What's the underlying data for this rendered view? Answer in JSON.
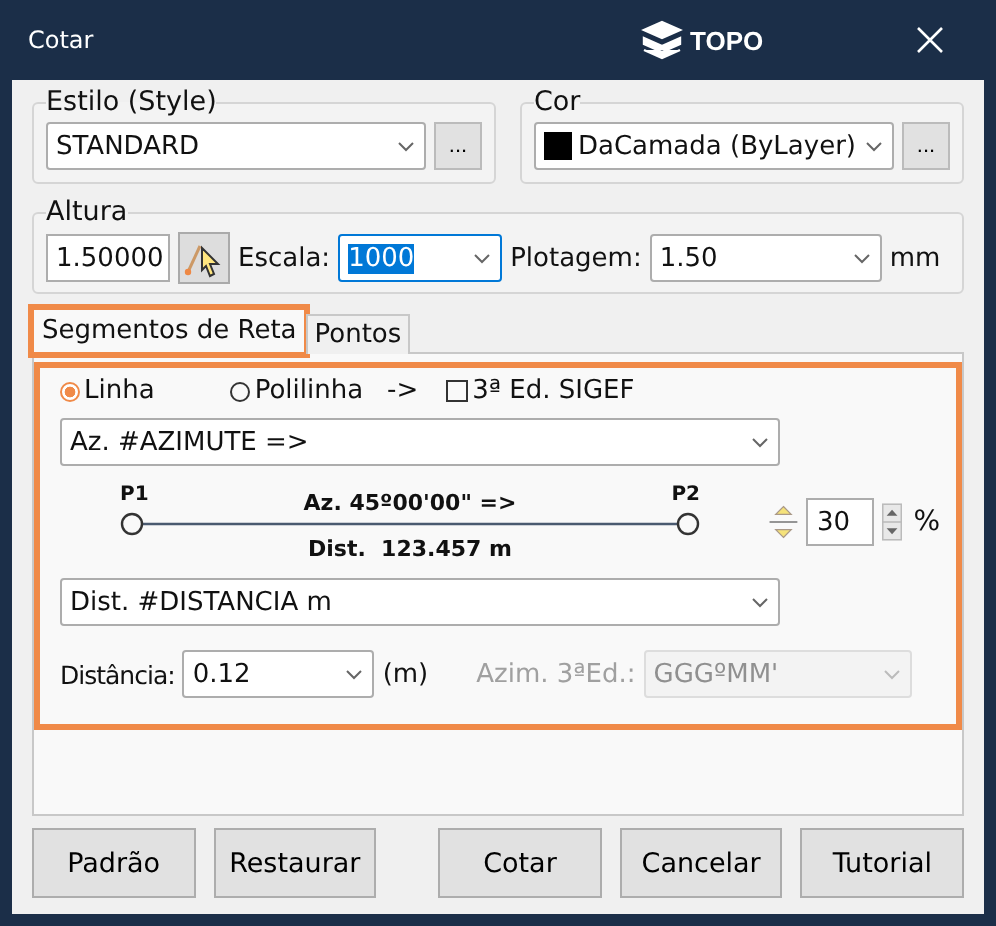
{
  "window": {
    "title": "Cotar",
    "logo_text": "TOPO"
  },
  "style_group": {
    "label": "Estilo (Style)",
    "value": "STANDARD",
    "more": "..."
  },
  "color_group": {
    "label": "Cor",
    "value": "DaCamada (ByLayer)",
    "more": "..."
  },
  "height_group": {
    "label": "Altura",
    "value": "1.50000",
    "scale_label": "Escala:",
    "scale_value": "1000",
    "plot_label": "Plotagem:",
    "plot_value": "1.50",
    "unit": "mm"
  },
  "tabs": [
    {
      "label": "Segmentos de Reta",
      "selected": true,
      "highlighted": true
    },
    {
      "label": "Pontos",
      "selected": false,
      "highlighted": false
    }
  ],
  "panel": {
    "highlighted": true,
    "options": [
      {
        "kind": "radio",
        "label": "Linha",
        "checked": true
      },
      {
        "kind": "radio",
        "label": "Polilinha",
        "checked": false
      },
      {
        "kind": "text",
        "label": "->"
      },
      {
        "kind": "checkbox",
        "label": "3ª Ed. SIGEF",
        "checked": false
      }
    ],
    "top_format": "Az. #AZIMUTE =>",
    "preview": {
      "p1": "P1",
      "p2": "P2",
      "top": "Az. 45º00'00\" =>",
      "bottom": "Dist.  123.457 m"
    },
    "offset_value": "30",
    "offset_unit": "%",
    "bottom_format": "Dist. #DISTANCIA m",
    "distance_label": "Distância:",
    "distance_value": "0.12",
    "distance_unit": "(m)",
    "azimuth_label": "Azim. 3ªEd.:",
    "azimuth_value": "GGGºMM'",
    "azimuth_disabled": true
  },
  "buttons": [
    "Padrão",
    "Restaurar",
    "Cotar",
    "Cancelar",
    "Tutorial"
  ]
}
